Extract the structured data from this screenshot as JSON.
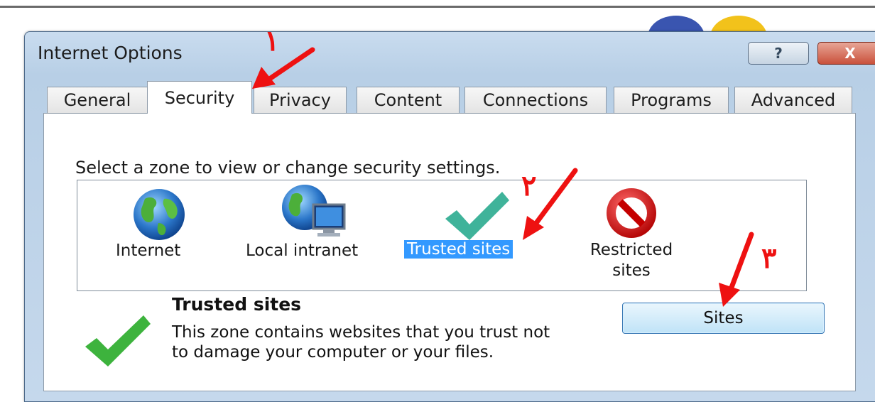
{
  "window": {
    "title": "Internet Options",
    "help_label": "?",
    "close_label": "X"
  },
  "tabs": [
    {
      "label": "General",
      "active": false
    },
    {
      "label": "Security",
      "active": true
    },
    {
      "label": "Privacy",
      "active": false
    },
    {
      "label": "Content",
      "active": false
    },
    {
      "label": "Connections",
      "active": false
    },
    {
      "label": "Programs",
      "active": false
    },
    {
      "label": "Advanced",
      "active": false
    }
  ],
  "security": {
    "instruction": "Select a zone to view or change security settings.",
    "zones": [
      {
        "label": "Internet",
        "icon": "globe-icon",
        "selected": false
      },
      {
        "label": "Local intranet",
        "icon": "globe-computer-icon",
        "selected": false
      },
      {
        "label": "Trusted sites",
        "icon": "checkmark-icon",
        "selected": true
      },
      {
        "label": "Restricted\nsites",
        "icon": "no-entry-icon",
        "selected": false
      }
    ],
    "selected_zone": {
      "title": "Trusted sites",
      "description": "This zone contains websites that you trust not to damage your computer or your files.",
      "icon": "green-checkmark-icon"
    },
    "sites_button": "Sites"
  },
  "annotations": {
    "step1": "١",
    "step2": "٢",
    "step3": "٣"
  },
  "colors": {
    "selection": "#3399ff",
    "annotation_arrow": "#ee1111",
    "trusted_check": "#3fb39a",
    "detail_check": "#3db33d",
    "restricted": "#d01010"
  }
}
